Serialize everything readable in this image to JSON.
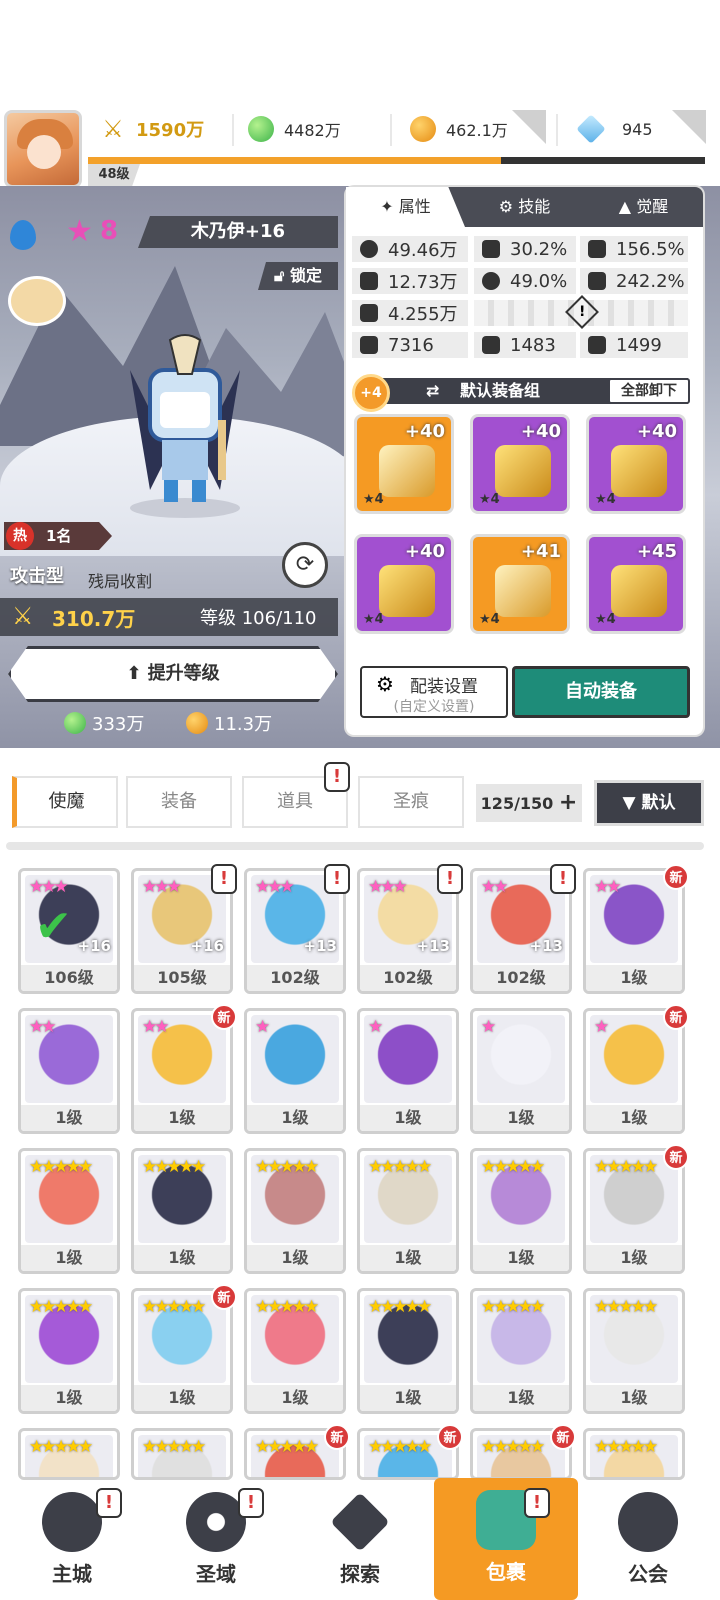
{
  "header": {
    "player_level": "48级",
    "power": "1590万",
    "green_orb": "4482万",
    "gold": "462.1万",
    "diamond": "945",
    "exp_fraction": 0.67
  },
  "hero": {
    "star_count": "8",
    "name": "木乃伊+16",
    "lock_label": "锁定",
    "hot_rank": "1名",
    "hot_icon": "热",
    "type": "攻击型",
    "role": "残局收割",
    "power": "310.7万",
    "level": "等级 106/110",
    "upgrade_label": "提升等级",
    "cost_green": "333万",
    "cost_gold": "11.3万"
  },
  "panel": {
    "tabs": [
      "属性",
      "技能",
      "觉醒"
    ],
    "stats": {
      "hp": "49.46万",
      "crit": "30.2%",
      "crit_dmg": "156.5%",
      "atk": "12.73万",
      "hit": "49.0%",
      "speed_pct": "242.2%",
      "def": "4.255万",
      "s1": "7316",
      "s2": "1483",
      "s3": "1499"
    },
    "equip_set_badge": "+4",
    "equip_set_label": "默认装备组",
    "unequip_label": "全部卸下",
    "equipment": [
      {
        "level": "+40",
        "stars": "★4",
        "rarity": "orange",
        "icon": "sword-icon"
      },
      {
        "level": "+40",
        "stars": "★4",
        "rarity": "purple",
        "icon": "helmet-icon"
      },
      {
        "level": "+40",
        "stars": "★4",
        "rarity": "purple",
        "icon": "armor-icon"
      },
      {
        "level": "+40",
        "stars": "★4",
        "rarity": "purple",
        "icon": "belt-icon"
      },
      {
        "level": "+41",
        "stars": "★4",
        "rarity": "orange",
        "icon": "necklace-icon"
      },
      {
        "level": "+45",
        "stars": "★4",
        "rarity": "purple",
        "icon": "boots-icon"
      }
    ],
    "config_label": "配装设置",
    "config_sub": "(自定义设置)",
    "auto_label": "自动装备"
  },
  "bag": {
    "tabs": [
      "使魔",
      "装备",
      "道具",
      "圣痕"
    ],
    "count": "125/150",
    "count_plus": "+",
    "sort_label": "▼ 默认",
    "new_tag": "新",
    "alert_mark": "!",
    "cards": [
      {
        "stars": "★★★",
        "pink": true,
        "plus": "+16",
        "level": "106级",
        "color": "#3d3f58"
      },
      {
        "stars": "★★★",
        "pink": true,
        "plus": "+16",
        "level": "105级",
        "color": "#e8c77a"
      },
      {
        "stars": "★★★",
        "pink": true,
        "plus": "+13",
        "level": "102级",
        "color": "#5ab6e8"
      },
      {
        "stars": "★★★",
        "pink": true,
        "plus": "+13",
        "level": "102级",
        "color": "#f3dca4"
      },
      {
        "stars": "★★",
        "pink": true,
        "plus": "+13",
        "level": "102级",
        "color": "#e86a5a"
      },
      {
        "stars": "★★",
        "pink": true,
        "plus": "",
        "level": "1级",
        "color": "#8a55c8"
      },
      {
        "stars": "★★",
        "pink": true,
        "plus": "",
        "level": "1级",
        "color": "#9a6ad8"
      },
      {
        "stars": "★★",
        "pink": true,
        "plus": "",
        "level": "1级",
        "color": "#f5c14a"
      },
      {
        "stars": "★",
        "pink": true,
        "plus": "",
        "level": "1级",
        "color": "#4aa8e0"
      },
      {
        "stars": "★",
        "pink": true,
        "plus": "",
        "level": "1级",
        "color": "#8d4fc8"
      },
      {
        "stars": "★",
        "pink": true,
        "plus": "",
        "level": "1级",
        "color": "#f2f2f8"
      },
      {
        "stars": "★",
        "pink": true,
        "plus": "",
        "level": "1级",
        "color": "#f5c14a"
      },
      {
        "stars": "★★★★★",
        "pink": false,
        "plus": "",
        "level": "1级",
        "color": "#ef7a6a"
      },
      {
        "stars": "★★★★★",
        "pink": false,
        "plus": "",
        "level": "1级",
        "color": "#3d3f58"
      },
      {
        "stars": "★★★★★",
        "pink": false,
        "plus": "",
        "level": "1级",
        "color": "#c78a8a"
      },
      {
        "stars": "★★★★★",
        "pink": false,
        "plus": "",
        "level": "1级",
        "color": "#e0d8c8"
      },
      {
        "stars": "★★★★★",
        "pink": false,
        "plus": "",
        "level": "1级",
        "color": "#b78ad8"
      },
      {
        "stars": "★★★★★",
        "pink": false,
        "plus": "",
        "level": "1级",
        "color": "#cfcfcf"
      },
      {
        "stars": "★★★★★",
        "pink": false,
        "plus": "",
        "level": "1级",
        "color": "#a55ad8"
      },
      {
        "stars": "★★★★★",
        "pink": false,
        "plus": "",
        "level": "1级",
        "color": "#8ad0f0"
      },
      {
        "stars": "★★★★★",
        "pink": false,
        "plus": "",
        "level": "1级",
        "color": "#ef7a8a"
      },
      {
        "stars": "★★★★★",
        "pink": false,
        "plus": "",
        "level": "1级",
        "color": "#3d3f58"
      },
      {
        "stars": "★★★★★",
        "pink": false,
        "plus": "",
        "level": "1级",
        "color": "#c8b8e8"
      },
      {
        "stars": "★★★★★",
        "pink": false,
        "plus": "",
        "level": "1级",
        "color": "#e8e8e8"
      },
      {
        "stars": "★★★★★",
        "pink": false,
        "plus": "",
        "level": "",
        "color": "#f2e2c8"
      },
      {
        "stars": "★★★★★",
        "pink": false,
        "plus": "",
        "level": "",
        "color": "#e0e0e0"
      },
      {
        "stars": "★★★★★",
        "pink": false,
        "plus": "",
        "level": "",
        "color": "#e86a5a"
      },
      {
        "stars": "★★★★★",
        "pink": false,
        "plus": "",
        "level": "",
        "color": "#5ab6e8"
      },
      {
        "stars": "★★★★★",
        "pink": false,
        "plus": "",
        "level": "",
        "color": "#e8c8a0"
      },
      {
        "stars": "★★★★★",
        "pink": false,
        "plus": "",
        "level": "",
        "color": "#f3d8a4"
      }
    ]
  },
  "nav": {
    "items": [
      "主城",
      "圣域",
      "探索",
      "包裹",
      "公会"
    ]
  }
}
